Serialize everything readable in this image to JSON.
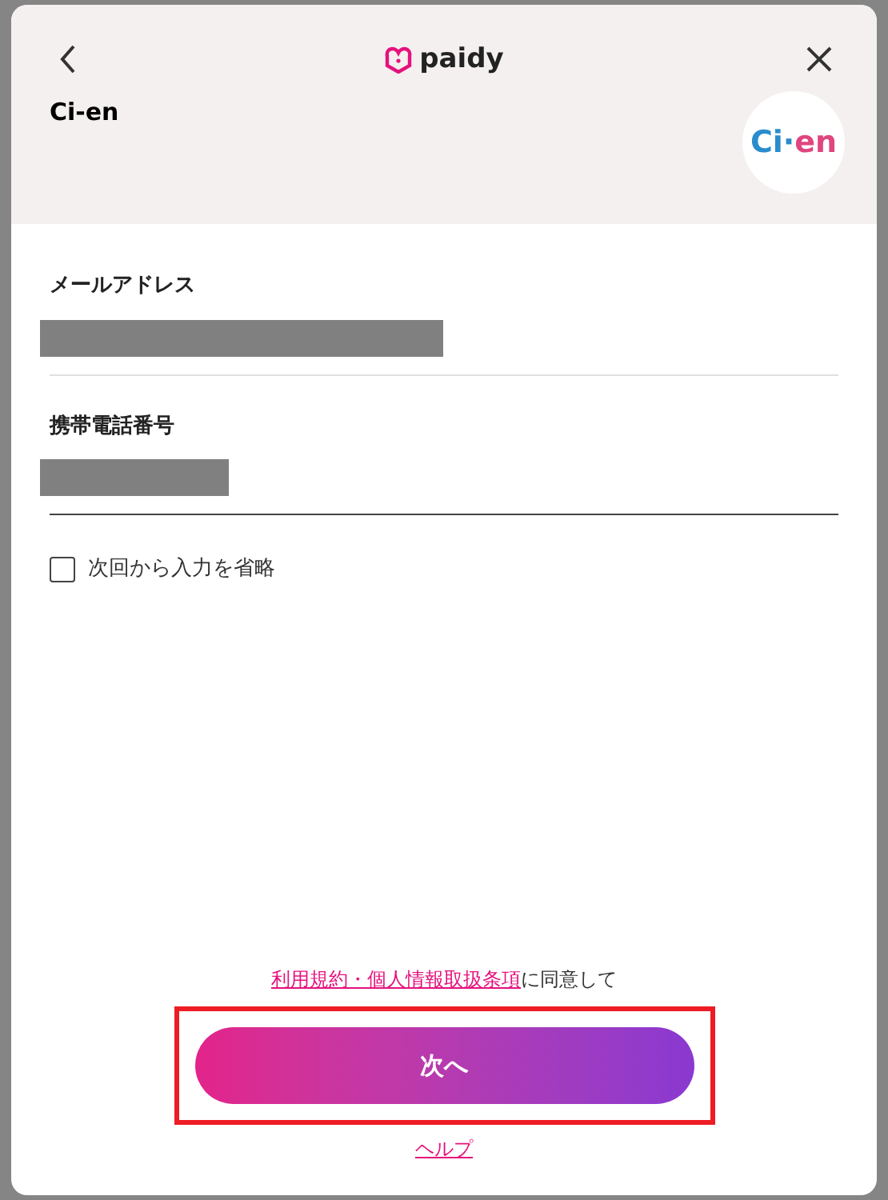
{
  "header": {
    "brand": "paidy",
    "merchant_name": "Ci-en",
    "merchant_logo": {
      "part_1": "Ci",
      "part_2": "·",
      "part_3": "en"
    }
  },
  "fields": [
    {
      "label": "メールアドレス",
      "focused": false
    },
    {
      "label": "携帯電話番号",
      "focused": true
    }
  ],
  "remember": {
    "label": "次回から入力を省略",
    "checked": false
  },
  "consent": {
    "link": "利用規約・個人情報取扱条項",
    "text": "に同意して"
  },
  "next_button": {
    "label": "次へ",
    "highlighted": true
  },
  "help_link": "ヘルプ"
}
